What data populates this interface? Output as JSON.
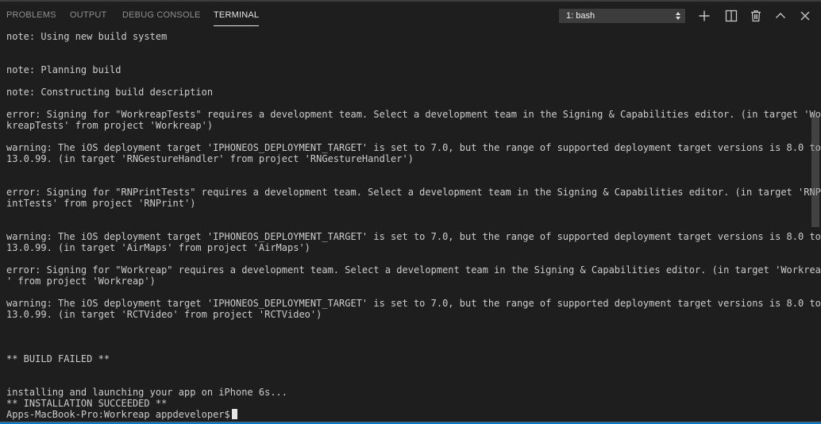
{
  "tabs": [
    {
      "label": "PROBLEMS"
    },
    {
      "label": "OUTPUT"
    },
    {
      "label": "DEBUG CONSOLE"
    },
    {
      "label": "TERMINAL",
      "active": true
    }
  ],
  "terminal_select": {
    "value": "1: bash"
  },
  "toolbar_icons": [
    "plus-icon",
    "split-icon",
    "trash-icon",
    "chevron-up-icon",
    "close-icon"
  ],
  "colors": {
    "background": "#1e1e1e",
    "text": "#cccccc",
    "accent": "#007acc"
  },
  "terminal": {
    "lines": [
      "note: Using new build system",
      "",
      "",
      "note: Planning build",
      "",
      "note: Constructing build description",
      "",
      "error: Signing for \"WorkreapTests\" requires a development team. Select a development team in the Signing & Capabilities editor. (in target 'Wor",
      "kreapTests' from project 'Workreap')",
      "",
      "warning: The iOS deployment target 'IPHONEOS_DEPLOYMENT_TARGET' is set to 7.0, but the range of supported deployment target versions is 8.0 to",
      "13.0.99. (in target 'RNGestureHandler' from project 'RNGestureHandler')",
      "",
      "",
      "error: Signing for \"RNPrintTests\" requires a development team. Select a development team in the Signing & Capabilities editor. (in target 'RNPr",
      "intTests' from project 'RNPrint')",
      "",
      "",
      "warning: The iOS deployment target 'IPHONEOS_DEPLOYMENT_TARGET' is set to 7.0, but the range of supported deployment target versions is 8.0 to",
      "13.0.99. (in target 'AirMaps' from project 'AirMaps')",
      "",
      "error: Signing for \"Workreap\" requires a development team. Select a development team in the Signing & Capabilities editor. (in target 'Workreap",
      "' from project 'Workreap')",
      "",
      "warning: The iOS deployment target 'IPHONEOS_DEPLOYMENT_TARGET' is set to 7.0, but the range of supported deployment target versions is 8.0 to",
      "13.0.99. (in target 'RCTVideo' from project 'RCTVideo')",
      "",
      "",
      "",
      "** BUILD FAILED **",
      "",
      "",
      "installing and launching your app on iPhone 6s...",
      "** INSTALLATION SUCCEEDED **"
    ],
    "prompt": "Apps-MacBook-Pro:Workreap appdeveloper$"
  }
}
